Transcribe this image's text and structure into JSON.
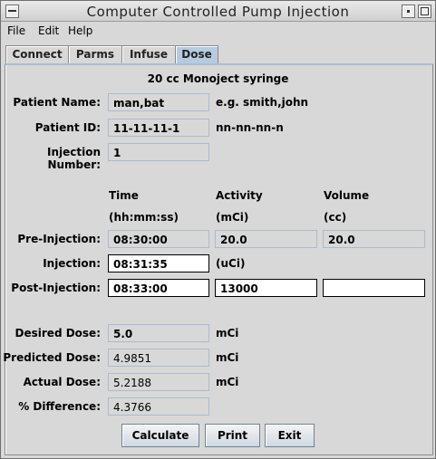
{
  "window": {
    "title": "Computer Controlled Pump Injection"
  },
  "menu": [
    "File",
    "Edit",
    "Help"
  ],
  "tabs": [
    {
      "label": "Connect",
      "active": false
    },
    {
      "label": "Parms",
      "active": false
    },
    {
      "label": "Infuse",
      "active": false
    },
    {
      "label": "Dose",
      "active": true
    }
  ],
  "dose": {
    "syringe_title": "20 cc Monoject syringe",
    "patient_name": {
      "label": "Patient Name:",
      "value": "man,bat",
      "hint": "e.g. smith,john"
    },
    "patient_id": {
      "label": "Patient ID:",
      "value": "11-11-11-1",
      "hint": "nn-nn-nn-n"
    },
    "injection_number": {
      "label": "Injection Number:",
      "value": "1"
    },
    "columns": {
      "time": "Time",
      "time_unit": "(hh:mm:ss)",
      "activity": "Activity",
      "activity_unit": "(mCi)",
      "volume": "Volume",
      "volume_unit": "(cc)"
    },
    "pre_injection": {
      "label": "Pre-Injection:",
      "time": "08:30:00",
      "activity": "20.0",
      "volume": "20.0"
    },
    "injection": {
      "label": "Injection:",
      "time": "08:31:35",
      "unit": "(uCi)"
    },
    "post_injection": {
      "label": "Post-Injection:",
      "time": "08:33:00",
      "activity": "13000",
      "volume": ""
    },
    "desired_dose": {
      "label": "Desired Dose:",
      "value": "5.0",
      "unit": "mCi"
    },
    "predicted_dose": {
      "label": "Predicted Dose:",
      "value": "4.9851",
      "unit": "mCi"
    },
    "actual_dose": {
      "label": "Actual Dose:",
      "value": "5.2188",
      "unit": "mCi"
    },
    "percent_difference": {
      "label": "% Difference:",
      "value": "4.3766"
    }
  },
  "buttons": {
    "calculate": "Calculate",
    "print": "Print",
    "exit": "Exit"
  },
  "colors": {
    "tab_active": "#b6cbe0",
    "field_border": "#a8bccf",
    "background": "#d8d8d8"
  }
}
